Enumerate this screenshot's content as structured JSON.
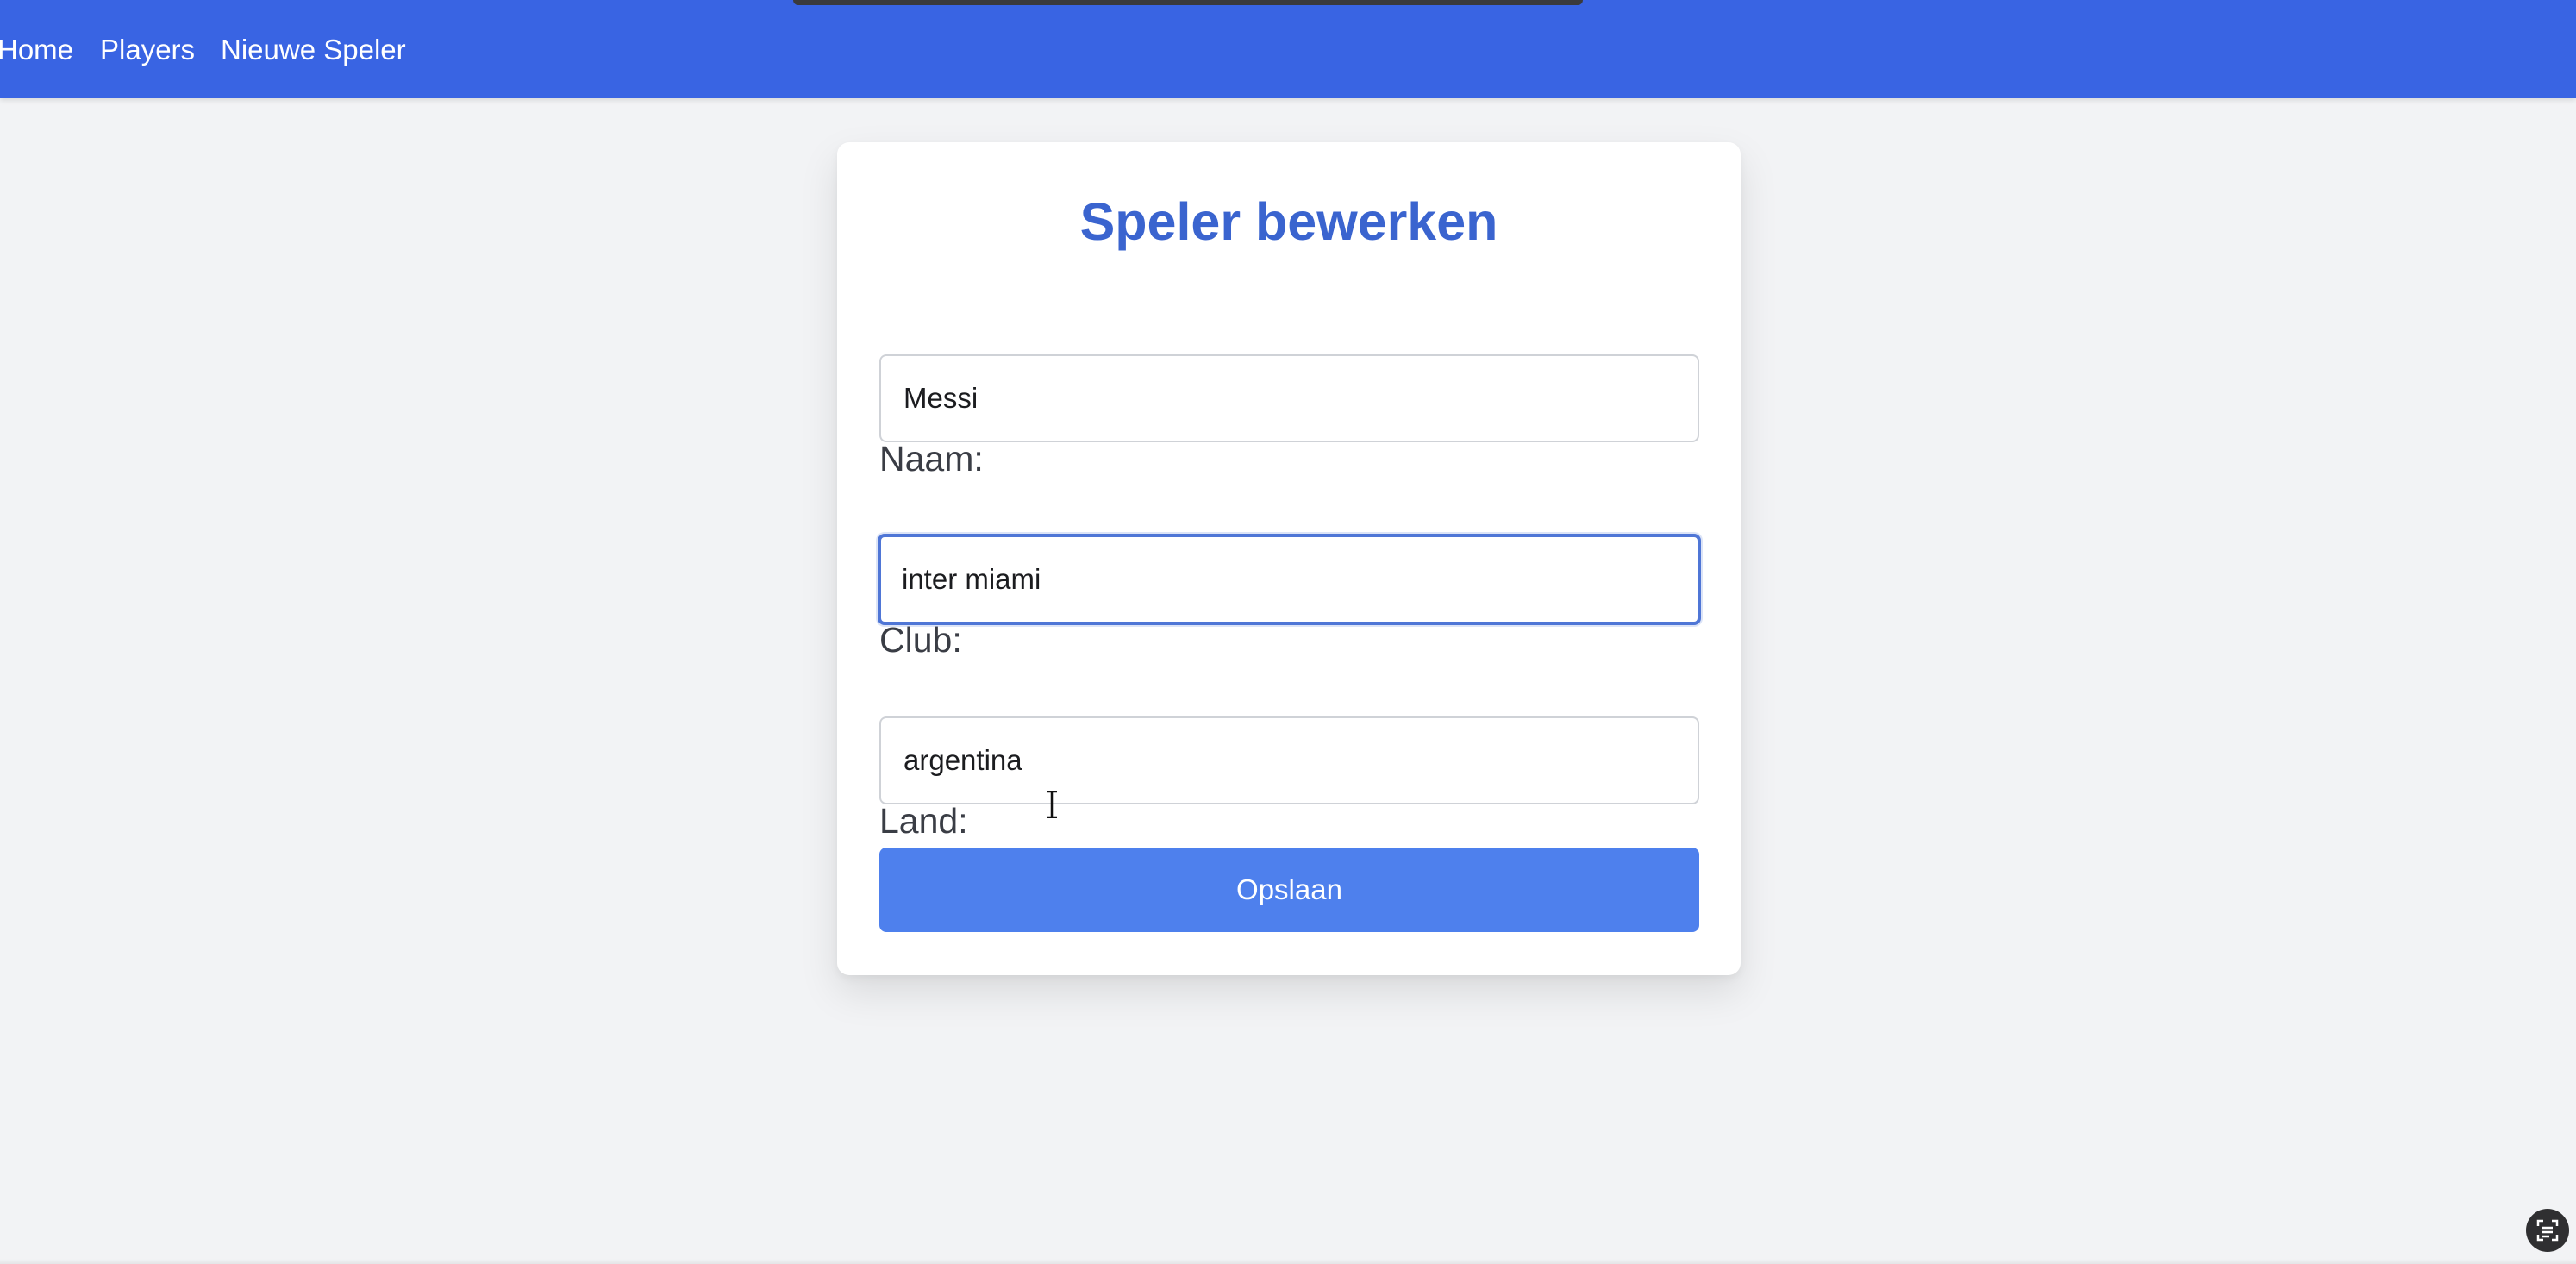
{
  "nav": {
    "home": "Home",
    "players": "Players",
    "new_player": "Nieuwe Speler"
  },
  "form": {
    "title": "Speler bewerken",
    "name_label": "Naam:",
    "name_value": "Messi",
    "club_label": "Club:",
    "club_value": "inter miami",
    "country_label": "Land:",
    "country_value": "argentina",
    "save_label": "Opslaan"
  },
  "icons": {
    "text_cursor": "i-beam-cursor-icon",
    "corner": "live-text-icon"
  },
  "colors": {
    "navbar": "#3964e3",
    "title": "#3a64cf",
    "button": "#4e80ed",
    "focus_border": "#4f76d6",
    "page_background": "#f2f3f5"
  }
}
